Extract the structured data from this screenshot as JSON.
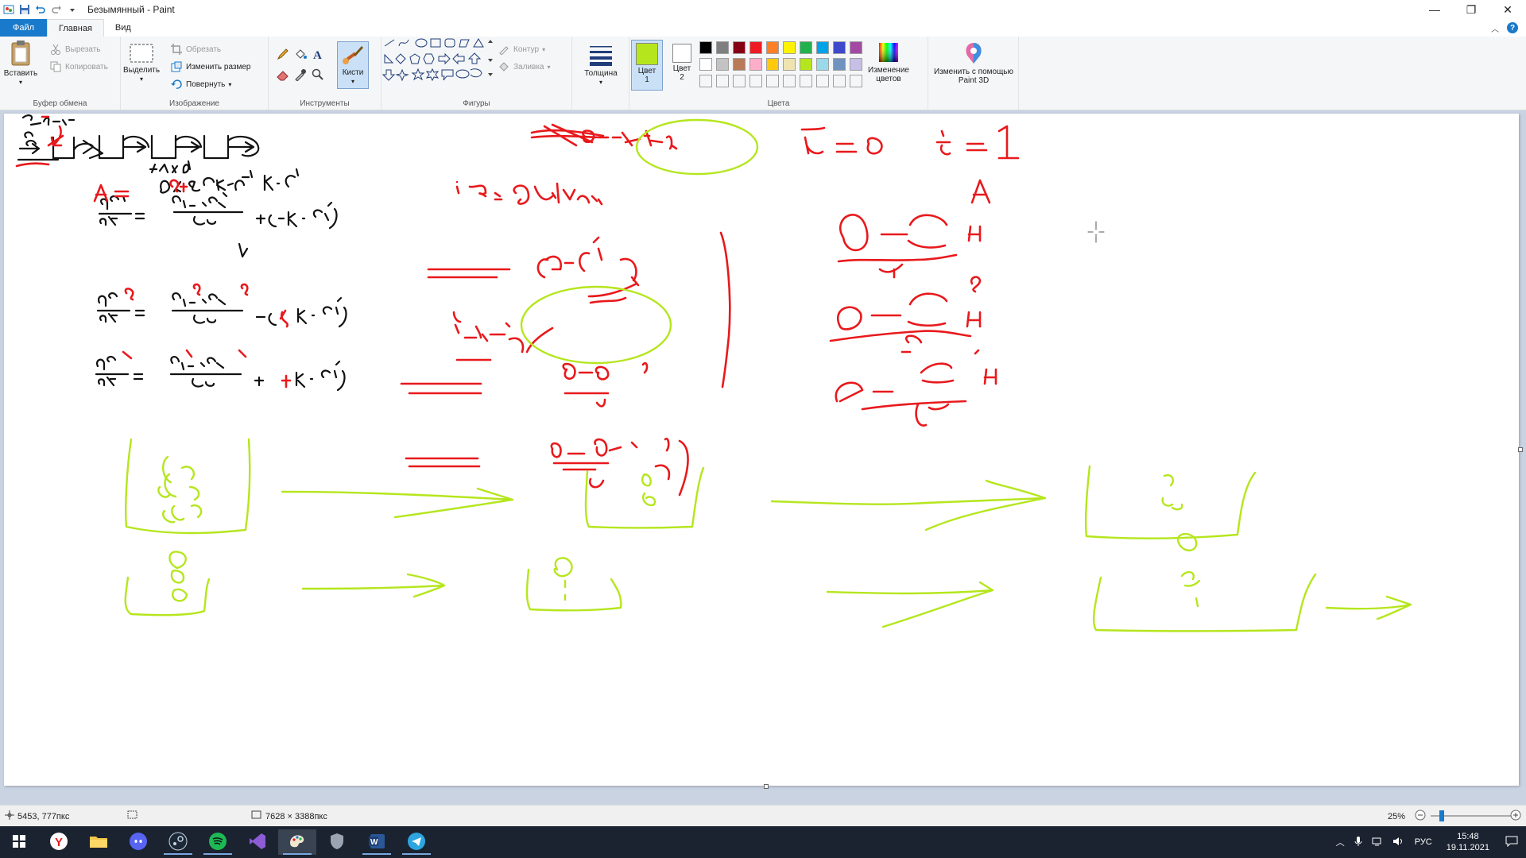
{
  "window": {
    "title": "Безымянный - Paint",
    "controls": [
      "minimize",
      "maximize",
      "close"
    ]
  },
  "tabs": [
    {
      "label": "Файл"
    },
    {
      "label": "Главная"
    },
    {
      "label": "Вид"
    }
  ],
  "ribbon": {
    "clipboard": {
      "label": "Буфер обмена",
      "paste": "Вставить",
      "cut": "Вырезать",
      "copy": "Копировать"
    },
    "image": {
      "label": "Изображение",
      "select": "Выделить",
      "crop": "Обрезать",
      "resize": "Изменить размер",
      "rotate": "Повернуть"
    },
    "tools": {
      "label": "Инструменты",
      "brushes": "Кисти"
    },
    "shapes": {
      "label": "Фигуры",
      "outline": "Контур",
      "fill": "Заливка"
    },
    "size": {
      "label": "Толщина"
    },
    "colors": {
      "label": "Цвета",
      "color1": "Цвет 1",
      "color2": "Цвет 2",
      "color1_value": "#b5e61d",
      "color2_value": "#ffffff",
      "edit_colors": "Изменение цветов",
      "paint3d": "Изменить с помощью Paint 3D",
      "palette_row1": [
        "#000000",
        "#7f7f7f",
        "#880015",
        "#ed1c24",
        "#ff7f27",
        "#fff200",
        "#22b14c",
        "#00a2e8",
        "#3f48cc",
        "#a349a4"
      ],
      "palette_row2": [
        "#ffffff",
        "#c3c3c3",
        "#b97a57",
        "#ffaec9",
        "#ffc90e",
        "#efe4b0",
        "#b5e61d",
        "#99d9ea",
        "#7092be",
        "#c8bfe7"
      ]
    }
  },
  "canvas_text": {
    "red_t0": "t = 0",
    "red_i1": "i = 1"
  },
  "status": {
    "cursor_pos": "5453, 777пкс",
    "image_size": "7628 × 3388пкс",
    "zoom": "25%"
  },
  "taskbar": {
    "apps": [
      "start-icon",
      "yandex-browser-icon",
      "file-explorer-icon",
      "discord-icon",
      "steam-icon",
      "spotify-icon",
      "visual-studio-icon",
      "paint-icon",
      "shield-app-icon",
      "word-icon",
      "telegram-icon"
    ],
    "lang": "РУС",
    "time": "15:48",
    "date": "19.11.2021"
  }
}
